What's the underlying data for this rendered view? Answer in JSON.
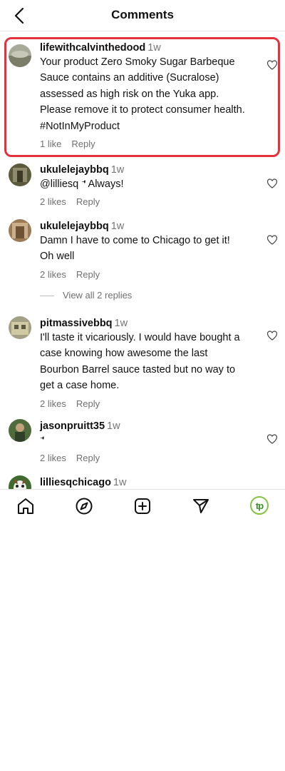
{
  "header": {
    "title": "Comments"
  },
  "comments": [
    {
      "username": "lifewithcalvinthedood",
      "time": "1w",
      "text": "Your product Zero Smoky Sugar Barbeque Sauce contains an additive (Sucralose) assessed as high risk on the Yuka app. Please remove it to protect consumer health. #NotInMyProduct",
      "likes": "1 like",
      "reply": "Reply"
    },
    {
      "username": "ukulelejaybbq",
      "time": "1w",
      "text": "@lilliesq 𝀀 Always!",
      "likes": "2 likes",
      "reply": "Reply"
    },
    {
      "username": "ukulelejaybbq",
      "time": "1w",
      "text": "Damn I have to come to Chicago to get it! Oh well",
      "likes": "2 likes",
      "reply": "Reply"
    },
    {
      "username": "pitmassivebbq",
      "time": "1w",
      "text": "I'll taste it vicariously. I would have bought a case knowing how awesome the last Bourbon Barrel sauce tasted but no way to get a case home.",
      "likes": "2 likes",
      "reply": "Reply"
    },
    {
      "username": "jasonpruitt35",
      "time": "1w",
      "text": "𝀀",
      "likes": "2 likes",
      "reply": "Reply"
    },
    {
      "username": "lilliesqchicago",
      "time": "1w",
      "text": "",
      "likes": "",
      "reply": ""
    }
  ],
  "view_replies": "View all 2 replies",
  "tabbar": {
    "profile_initials": "tp"
  },
  "colors": {
    "highlight": "#e5303e",
    "profile_ring": "#84c342"
  },
  "icons": [
    "back-arrow-icon",
    "heart-icon",
    "home-icon",
    "explore-icon",
    "create-icon",
    "send-icon"
  ]
}
